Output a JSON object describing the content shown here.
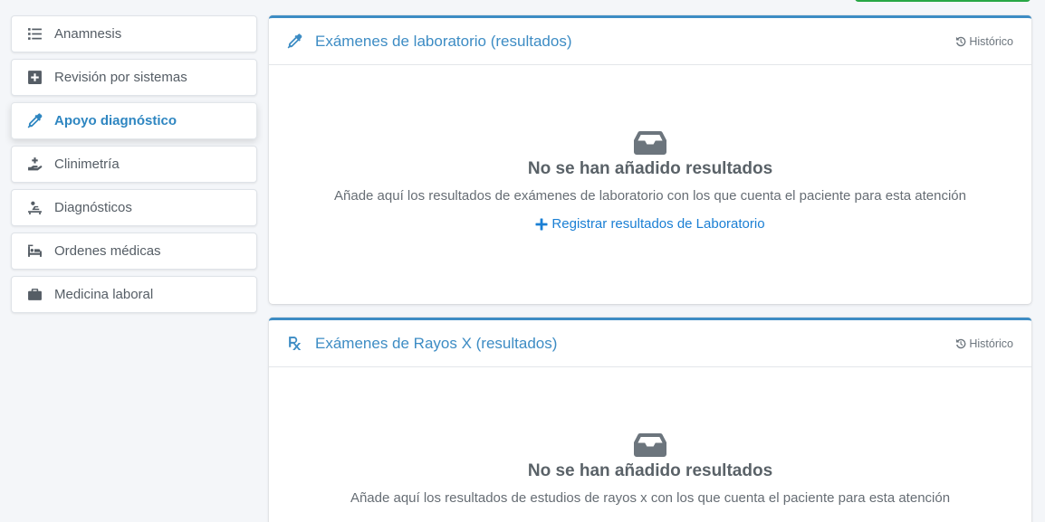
{
  "sidebar": {
    "items": [
      {
        "label": "Anamnesis",
        "icon": "list-icon",
        "active": false
      },
      {
        "label": "Revisión por sistemas",
        "icon": "plus-square-icon",
        "active": false
      },
      {
        "label": "Apoyo diagnóstico",
        "icon": "eyedropper-icon",
        "active": true
      },
      {
        "label": "Clinimetría",
        "icon": "hand-holding-medical-icon",
        "active": false
      },
      {
        "label": "Diagnósticos",
        "icon": "procedures-icon",
        "active": false
      },
      {
        "label": "Ordenes médicas",
        "icon": "bed-icon",
        "active": false
      },
      {
        "label": "Medicina laboral",
        "icon": "briefcase-medical-icon",
        "active": false
      }
    ]
  },
  "lab_card": {
    "title": "Exámenes de laboratorio (resultados)",
    "historico_label": "Histórico",
    "empty_title": "No se han añadido resultados",
    "empty_desc": "Añade aquí los resultados de exámenes de laboratorio con los que cuenta el paciente para esta atención",
    "add_label": "Registrar resultados de Laboratorio"
  },
  "xray_card": {
    "title": "Exámenes de Rayos X (resultados)",
    "historico_label": "Histórico",
    "empty_title": "No se han añadido resultados",
    "empty_desc": "Añade aquí los resultados de estudios de rayos x con los que cuenta el paciente para esta atención"
  },
  "colors": {
    "accent": "#3d8cc4",
    "link": "#1a7fd4",
    "success": "#28a745"
  }
}
